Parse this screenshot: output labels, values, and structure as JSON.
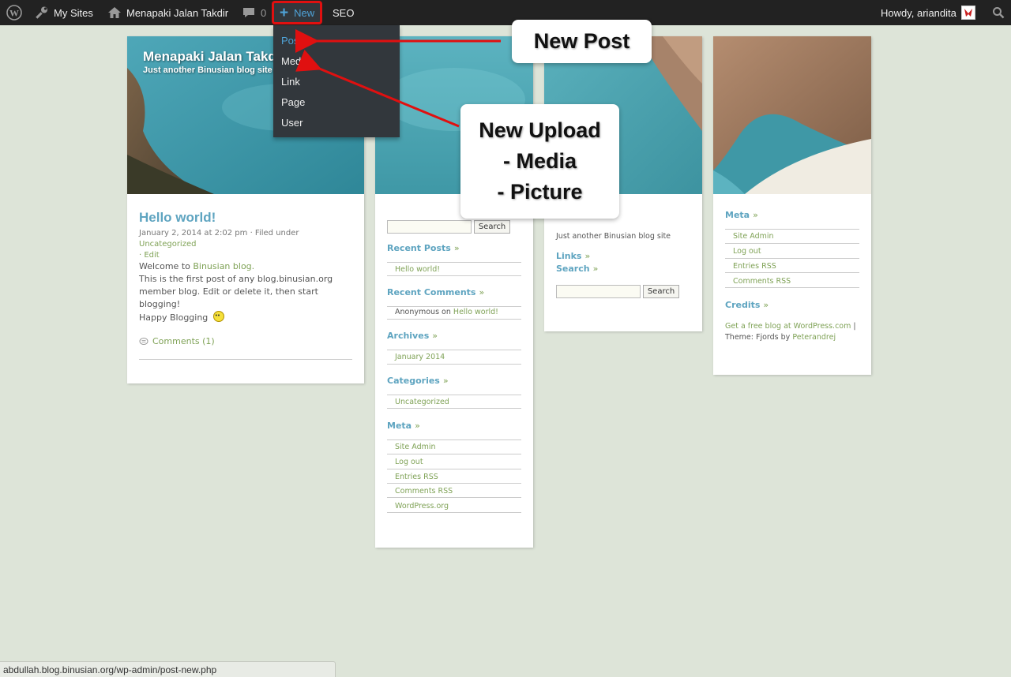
{
  "adminbar": {
    "my_sites": "My Sites",
    "site_name": "Menapaki Jalan Takdir",
    "comments_count": "0",
    "new_label": "New",
    "seo_label": "SEO",
    "howdy": "Howdy, ariandita"
  },
  "new_menu": {
    "items": [
      "Post",
      "Media",
      "Link",
      "Page",
      "User"
    ],
    "active": "Post"
  },
  "header": {
    "blog_title": "Menapaki Jalan Takdir",
    "tagline": "Just another Binusian blog site"
  },
  "post": {
    "title": "Hello world!",
    "date": "January 2, 2014 at 2:02 pm",
    "filed_under": "· Filed under",
    "category": "Uncategorized",
    "edit": "· Edit",
    "welcome_prefix": "Welcome to",
    "welcome_link": "Binusian blog.",
    "body": "This is the first post of any blog.binusian.org member blog. Edit or delete it, then start blogging!",
    "happy": "Happy Blogging",
    "comments": "Comments (1)"
  },
  "sidebar1": {
    "search_button": "Search",
    "recent_posts_title": "Recent Posts",
    "recent_posts": [
      "Hello world!"
    ],
    "recent_comments_title": "Recent Comments",
    "recent_comment_author": "Anonymous",
    "recent_comment_on": "on",
    "recent_comment_post": "Hello world!",
    "archives_title": "Archives",
    "archives": [
      "January 2014"
    ],
    "categories_title": "Categories",
    "categories": [
      "Uncategorized"
    ],
    "meta_title": "Meta",
    "meta": [
      "Site Admin",
      "Log out",
      "Entries RSS",
      "Comments RSS",
      "WordPress.org"
    ]
  },
  "sidebar2": {
    "tagline": "Just another Binusian blog site",
    "links_title": "Links",
    "search_title": "Search",
    "search_button": "Search"
  },
  "sidebar3": {
    "meta_title": "Meta",
    "meta": [
      "Site Admin",
      "Log out",
      "Entries RSS",
      "Comments RSS"
    ],
    "credits_title": "Credits",
    "credits_link": "Get a free blog at WordPress.com",
    "credits_sep": "|",
    "theme_prefix": "Theme: Fjords by",
    "theme_author": "Peterandrej"
  },
  "callouts": {
    "new_post": "New Post",
    "new_upload": [
      "New Upload",
      "- Media",
      "- Picture"
    ]
  },
  "statusbar": {
    "url": "abdullah.blog.binusian.org/wp-admin/post-new.php"
  },
  "colors": {
    "page_bg": "#dde4d8",
    "adminbar_bg": "#222222",
    "link_blue": "#5ea4c0",
    "link_green": "#7fa256",
    "highlight_red": "#e01010"
  }
}
